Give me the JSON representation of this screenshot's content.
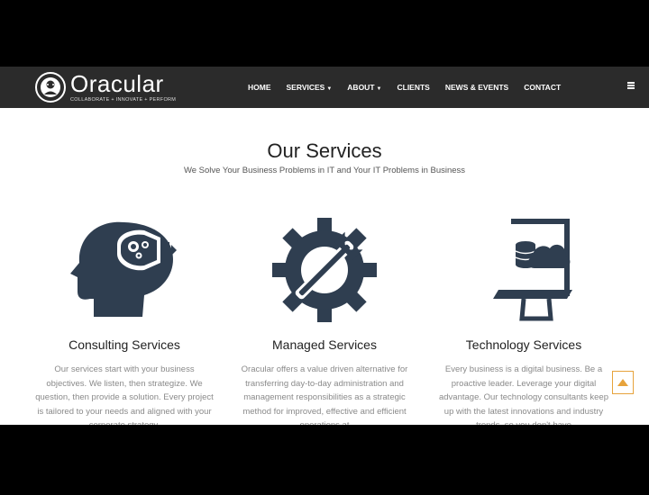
{
  "brand": {
    "name": "Oracular",
    "tagline": "COLLABORATE + INNOVATE + PERFORM"
  },
  "nav": {
    "items": [
      {
        "label": "HOME"
      },
      {
        "label": "SERVICES"
      },
      {
        "label": "ABOUT"
      },
      {
        "label": "CLIENTS"
      },
      {
        "label": "NEWS & EVENTS"
      },
      {
        "label": "CONTACT"
      }
    ],
    "menu_icon": "hamburger-icon"
  },
  "section": {
    "title": "Our Services",
    "subtitle": "We Solve Your Business Problems in IT and Your IT Problems in Business"
  },
  "services": [
    {
      "icon": "head-lightbulb-icon",
      "title": "Consulting Services",
      "desc": "Our services start with your business objectives. We listen, then strategize. We question, then provide a solution. Every project is tailored to your needs and aligned with your corporate strategy."
    },
    {
      "icon": "gear-wrench-icon",
      "title": "Managed Services",
      "desc": "Oracular offers a value driven alternative for transferring day-to-day administration and management responsibilities as a strategic method for improved, effective and efficient operations at"
    },
    {
      "icon": "monitor-cloud-database-icon",
      "title": "Technology Services",
      "desc": "Every business is a digital business. Be a proactive leader. Leverage your digital advantage. Our technology consultants keep up with the latest innovations and industry trends, so you don't have"
    }
  ],
  "colors": {
    "navbar": "#2b2b2b",
    "icon": "#2f3e50",
    "accent": "#e7a33c"
  }
}
